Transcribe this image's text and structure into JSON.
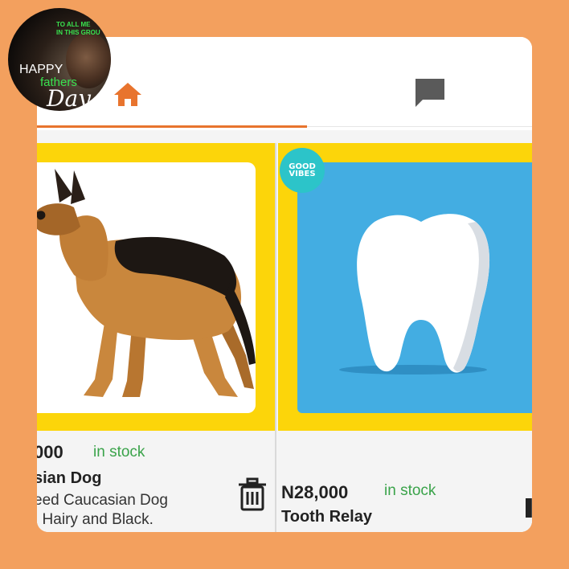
{
  "avatar": {
    "line1": "TO ALL ME",
    "line2": "IN THIS GROU",
    "happy": "HAPPY",
    "fathers": "fathers",
    "day": "Day"
  },
  "tabs": [
    {
      "icon": "home-icon",
      "active": true
    },
    {
      "icon": "chat-icon",
      "active": false
    }
  ],
  "products": [
    {
      "price": "000",
      "stock": "in stock",
      "title": "sian Dog",
      "description_line1": "eed Caucasian Dog",
      "description_line2": ". Hairy and Black.",
      "image": "german-shepherd-dog"
    },
    {
      "price": "N28,000",
      "stock": "in stock",
      "title": "Tooth Relay",
      "badge_line1": "GOOD",
      "badge_line2": "VIBES",
      "image": "tooth"
    }
  ],
  "colors": {
    "background": "#f3a05e",
    "accent": "#e8742e",
    "frame_yellow": "#fcd50a",
    "tooth_bg": "#43ade2",
    "in_stock": "#3aa34a",
    "badge": "#2cc4c9"
  }
}
